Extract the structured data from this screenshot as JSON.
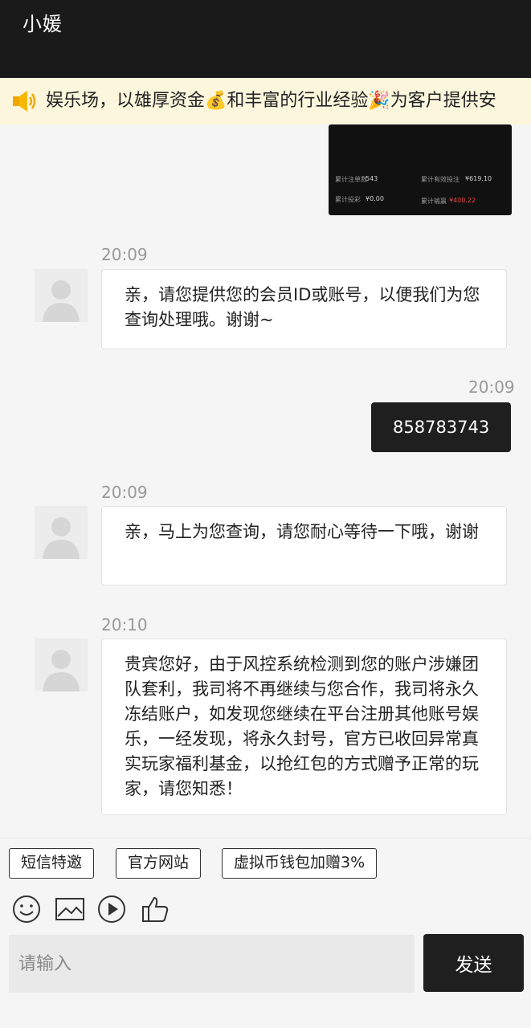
{
  "header": {
    "title": "小媛"
  },
  "notice": {
    "text": "娱乐场，以雄厚资金💰和丰富的行业经验🎉为客户提供安"
  },
  "messages": {
    "image": {
      "label1": "累计注单数",
      "value1": "543",
      "label2": "累计有效投注",
      "value2": "¥619.10",
      "label3": "累计投彩",
      "value3": "¥0.00",
      "label4": "累计输赢",
      "value4": "¥400.22"
    },
    "m1": {
      "time": "20:09",
      "text": "亲，请您提供您的会员ID或账号，以便我们为您查询处理哦。谢谢~"
    },
    "m2": {
      "time": "20:09",
      "text": "858783743"
    },
    "m3": {
      "time": "20:09",
      "text": "亲，马上为您查询，请您耐心等待一下哦，谢谢"
    },
    "m4": {
      "time": "20:10",
      "text": "贵宾您好，由于风控系统检测到您的账户涉嫌团队套利，我司将不再继续与您合作，我司将永久冻结账户，如发现您继续在平台注册其他账号娱乐，一经发现，将永久封号，官方已收回异常真实玩家福利基金，以抢红包的方式赠予正常的玩 家，请您知悉！"
    }
  },
  "quick_buttons": [
    "短信特邀",
    "官方网站",
    "虚拟币钱包加赠3%"
  ],
  "tools": [
    "smile-icon",
    "image-icon",
    "play-icon",
    "thumbs-up-icon"
  ],
  "input": {
    "placeholder": "请输入",
    "value": ""
  },
  "send": {
    "label": "发送"
  },
  "colors": {
    "accent": "#1f1f1f",
    "notice_bg": "#fbf6dc",
    "header_bg": "#1a1a1a"
  }
}
